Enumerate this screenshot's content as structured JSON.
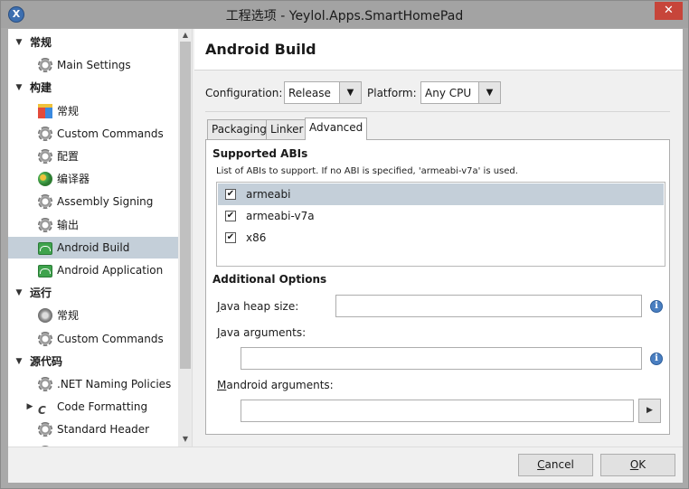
{
  "window": {
    "title": "工程选项 - Yeylol.Apps.SmartHomePad",
    "app_icon": "X",
    "close_glyph": "✕"
  },
  "sidebar": {
    "items": [
      {
        "type": "category",
        "label": "常规",
        "expanded": true
      },
      {
        "type": "item",
        "label": "Main Settings",
        "icon": "gear-icon"
      },
      {
        "type": "category",
        "label": "构建",
        "expanded": true
      },
      {
        "type": "item",
        "label": "常规",
        "icon": "blocks-icon"
      },
      {
        "type": "item",
        "label": "Custom Commands",
        "icon": "gear-icon"
      },
      {
        "type": "item",
        "label": "配置",
        "icon": "gear-icon"
      },
      {
        "type": "item",
        "label": "编译器",
        "icon": "compiler-icon"
      },
      {
        "type": "item",
        "label": "Assembly Signing",
        "icon": "gear-icon"
      },
      {
        "type": "item",
        "label": "输出",
        "icon": "gear-icon"
      },
      {
        "type": "item",
        "label": "Android Build",
        "icon": "android-icon",
        "selected": true
      },
      {
        "type": "item",
        "label": "Android Application",
        "icon": "android-icon"
      },
      {
        "type": "category",
        "label": "运行",
        "expanded": true
      },
      {
        "type": "item",
        "label": "常规",
        "icon": "run-icon"
      },
      {
        "type": "item",
        "label": "Custom Commands",
        "icon": "gear-icon"
      },
      {
        "type": "category",
        "label": "源代码",
        "expanded": true
      },
      {
        "type": "item",
        "label": ".NET Naming Policies",
        "icon": "gear-icon"
      },
      {
        "type": "item",
        "label": "Code Formatting",
        "icon": "code-formatting-icon",
        "collapsed_arrow": true
      },
      {
        "type": "item",
        "label": "Standard Header",
        "icon": "gear-icon"
      },
      {
        "type": "item",
        "label": "Name Conventions",
        "icon": "gear-icon",
        "clipped": true
      }
    ]
  },
  "main": {
    "heading": "Android Build",
    "configuration_label": "Configuration:",
    "configuration_value": "Release",
    "platform_label": "Platform:",
    "platform_value": "Any CPU",
    "tabs": [
      {
        "label": "Packaging",
        "active": false
      },
      {
        "label": "Linker",
        "active": false
      },
      {
        "label": "Advanced",
        "active": true
      }
    ],
    "supported_abis_title": "Supported ABIs",
    "supported_abis_desc": "List of ABIs to support. If no ABI is specified, 'armeabi-v7a' is used.",
    "abis": [
      {
        "label": "armeabi",
        "checked": true,
        "selected": true
      },
      {
        "label": "armeabi-v7a",
        "checked": true,
        "selected": false
      },
      {
        "label": "x86",
        "checked": true,
        "selected": false
      }
    ],
    "additional_options_title": "Additional Options",
    "java_heap_label_mnemonic": "J",
    "java_heap_label_rest": "ava heap size:",
    "java_heap_value": "",
    "java_args_label_mnemonic": "J",
    "java_args_label_rest": "ava arguments:",
    "java_args_value": "",
    "mandroid_label_mnemonic": "M",
    "mandroid_label_rest": "android arguments:",
    "mandroid_value": "",
    "check_glyph": "✔",
    "info_glyph": "i",
    "play_glyph": "▶"
  },
  "footer": {
    "cancel_mnemonic": "C",
    "cancel_rest": "ancel",
    "ok_mnemonic": "O",
    "ok_rest": "K"
  },
  "colors": {
    "selection": "#c4cfd9",
    "close": "#c7453a",
    "info": "#4a7fc1"
  }
}
